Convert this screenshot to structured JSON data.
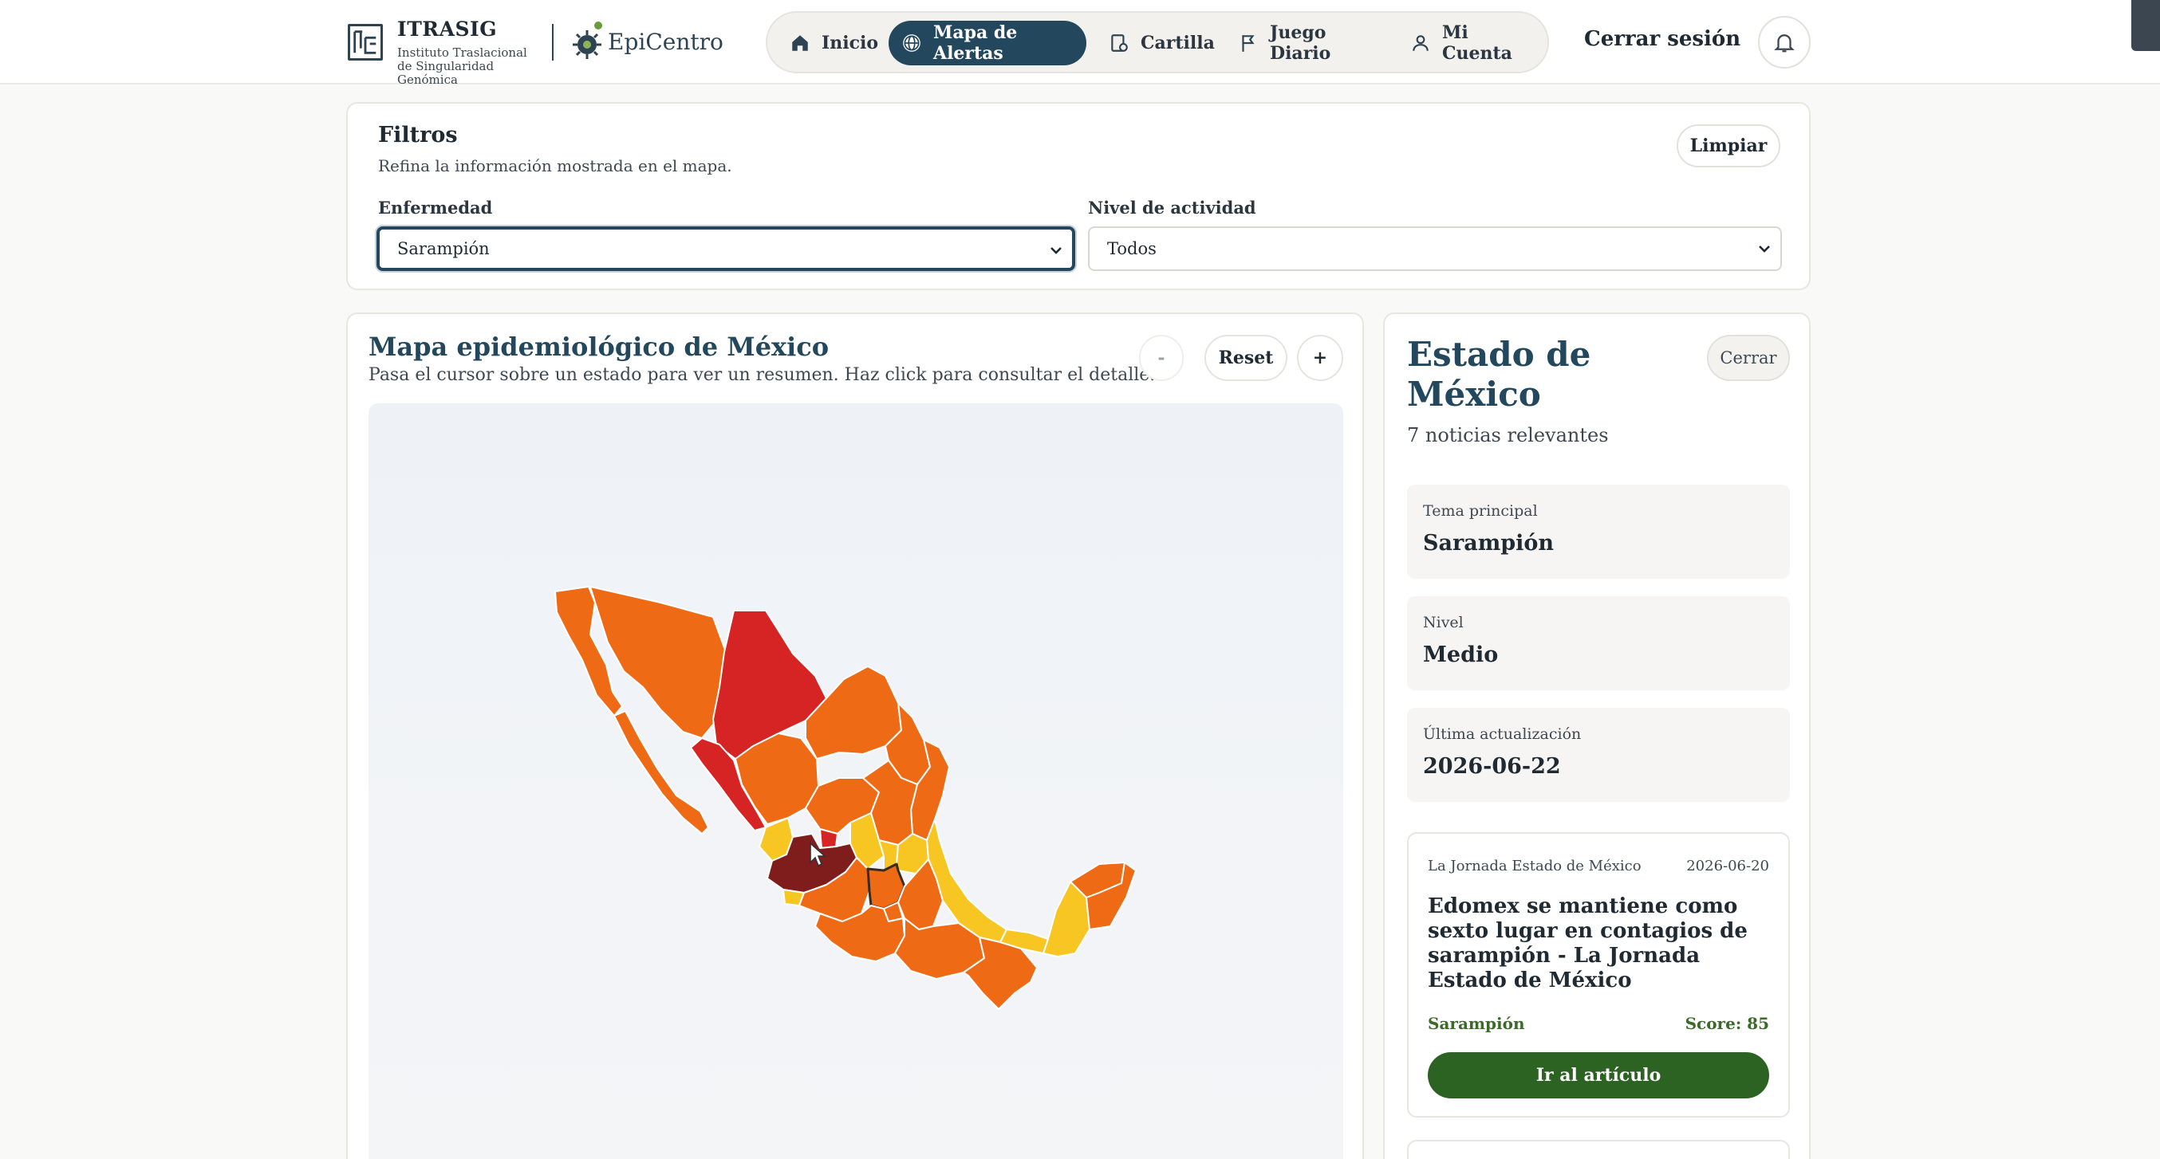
{
  "header": {
    "brand": {
      "name": "ITRASIG",
      "subtitle": "Instituto Traslacional de Singularidad Genómica",
      "partner": "EpiCentro"
    },
    "nav": [
      {
        "label": "Inicio",
        "icon": "home-icon",
        "active": false
      },
      {
        "label": "Mapa de Alertas",
        "icon": "globe-icon",
        "active": true
      },
      {
        "label": "Cartilla",
        "icon": "booklet-icon",
        "active": false
      },
      {
        "label": "Juego Diario",
        "icon": "flag-icon",
        "active": false
      },
      {
        "label": "Mi Cuenta",
        "icon": "user-icon",
        "active": false
      }
    ],
    "logout_label": "Cerrar sesión",
    "bell_icon": "bell-icon"
  },
  "filters": {
    "title": "Filtros",
    "subtitle": "Refina la información mostrada en el mapa.",
    "clear_label": "Limpiar",
    "disease": {
      "label": "Enfermedad",
      "value": "Sarampión"
    },
    "activity": {
      "label": "Nivel de actividad",
      "value": "Todos"
    }
  },
  "map": {
    "title": "Mapa epidemiológico de México",
    "subtitle": "Pasa el cursor sobre un estado para ver un resumen. Haz click para consultar el detalle.",
    "zoom_out_label": "-",
    "reset_label": "Reset",
    "zoom_in_label": "+",
    "level_colors": {
      "very_high": "#7f1d1d",
      "high": "#d62424",
      "medium": "#ef6a14",
      "low": "#f7c623"
    }
  },
  "detail": {
    "state_name": "Estado de México",
    "news_count": "7 noticias relevantes",
    "close_label": "Cerrar",
    "info": [
      {
        "label": "Tema principal",
        "value": "Sarampión"
      },
      {
        "label": "Nivel",
        "value": "Medio"
      },
      {
        "label": "Última actualización",
        "value": "2026-06-22"
      }
    ],
    "article": {
      "source": "La Jornada Estado de México",
      "date": "2026-06-20",
      "title": "Edomex se mantiene como sexto lugar en contagios de sarampión - La Jornada Estado de México",
      "tag": "Sarampión",
      "score": "Score: 85",
      "button_label": "Ir al artículo"
    }
  }
}
